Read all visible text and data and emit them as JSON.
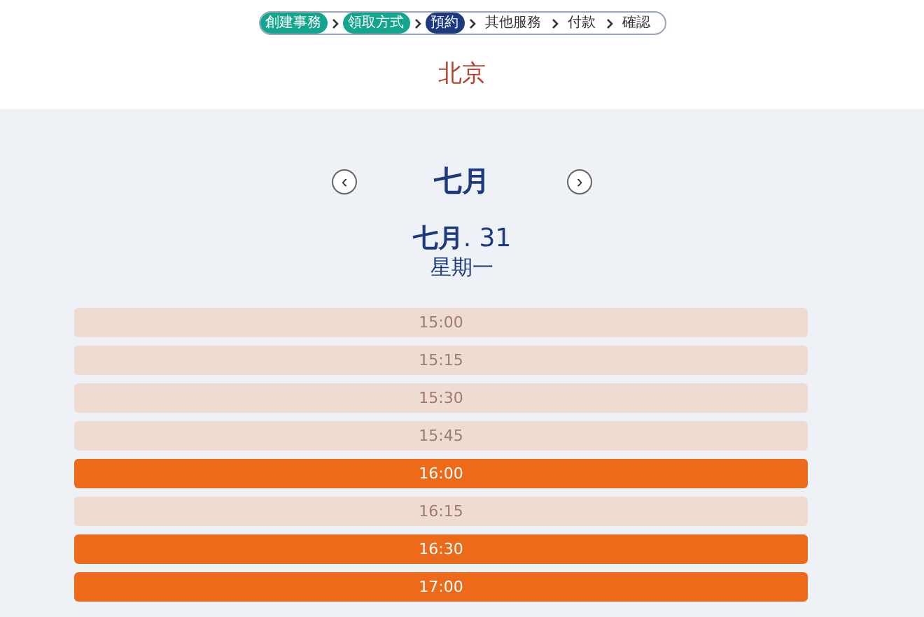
{
  "steps": [
    {
      "label": "創建事務",
      "done": true,
      "selected": false
    },
    {
      "label": "領取方式",
      "done": true,
      "selected": false
    },
    {
      "label": "預約",
      "done": false,
      "selected": true
    },
    {
      "label": "其他服務",
      "done": false,
      "selected": false
    },
    {
      "label": "付款",
      "done": false,
      "selected": false
    },
    {
      "label": "確認",
      "done": false,
      "selected": false
    }
  ],
  "city": "北京",
  "calendar": {
    "month": "七月",
    "prev": "‹",
    "next": "›",
    "date_month": "七月",
    "date_day": ". 31",
    "weekday": "星期一"
  },
  "slots": [
    {
      "time": "15:00",
      "available": false
    },
    {
      "time": "15:15",
      "available": false
    },
    {
      "time": "15:30",
      "available": false
    },
    {
      "time": "15:45",
      "available": false
    },
    {
      "time": "16:00",
      "available": true
    },
    {
      "time": "16:15",
      "available": false
    },
    {
      "time": "16:30",
      "available": true
    },
    {
      "time": "17:00",
      "available": true
    }
  ]
}
